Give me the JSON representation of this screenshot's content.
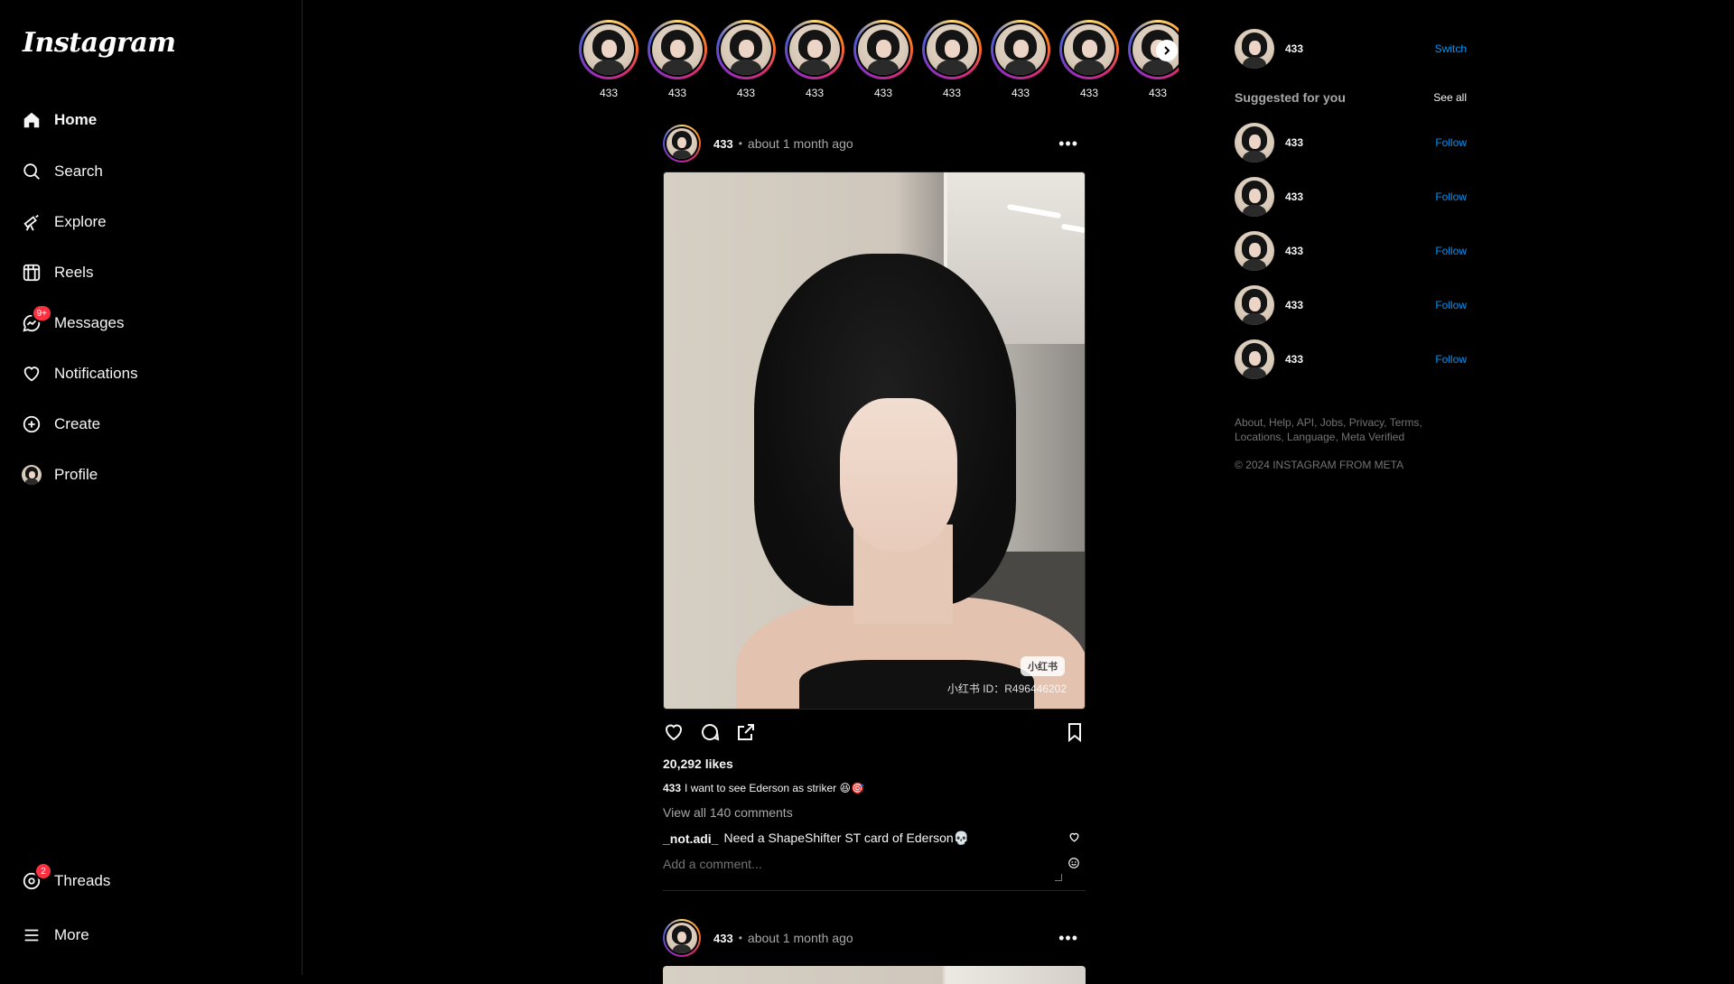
{
  "sidebar": {
    "logo": "Instagram",
    "items": [
      {
        "label": "Home",
        "icon": "home-icon"
      },
      {
        "label": "Search",
        "icon": "search-icon"
      },
      {
        "label": "Explore",
        "icon": "explore-icon"
      },
      {
        "label": "Reels",
        "icon": "reels-icon"
      },
      {
        "label": "Messages",
        "icon": "messages-icon",
        "badge": "9+"
      },
      {
        "label": "Notifications",
        "icon": "heart-icon"
      },
      {
        "label": "Create",
        "icon": "plus-circle-icon"
      },
      {
        "label": "Profile",
        "icon": "avatar"
      }
    ],
    "bottom": [
      {
        "label": "Threads",
        "icon": "threads-icon",
        "badge": "2"
      },
      {
        "label": "More",
        "icon": "hamburger-icon"
      }
    ]
  },
  "stories": [
    "433",
    "433",
    "433",
    "433",
    "433",
    "433",
    "433",
    "433",
    "433"
  ],
  "posts": [
    {
      "user": "433",
      "separator": "•",
      "time": "about 1 month ago",
      "likes": "20,292 likes",
      "caption_user": "433",
      "caption_text": "I want to see Ederson as striker 😆🎯",
      "view_all": "View all 140 comments",
      "comment_user": "_not.adi_",
      "comment_text": "Need a ShapeShifter ST card of Ederson💀",
      "add_comment_placeholder": "Add a comment...",
      "watermark_badge": "小红书",
      "watermark_id": "小红书 ID：R496446202"
    },
    {
      "user": "433",
      "separator": "•",
      "time": "about 1 month ago"
    }
  ],
  "right": {
    "me": {
      "name": "433",
      "action": "Switch"
    },
    "suggested_title": "Suggested for you",
    "see_all": "See all",
    "suggestions": [
      {
        "name": "433",
        "action": "Follow"
      },
      {
        "name": "433",
        "action": "Follow"
      },
      {
        "name": "433",
        "action": "Follow"
      },
      {
        "name": "433",
        "action": "Follow"
      },
      {
        "name": "433",
        "action": "Follow"
      }
    ],
    "footer_links": [
      "About",
      "Help",
      "API",
      "Jobs",
      "Privacy",
      "Terms",
      "Locations",
      "Language",
      "Meta Verified"
    ],
    "copyright": "© 2024 INSTAGRAM FROM META"
  },
  "colors": {
    "background": "#000000",
    "accent": "#0095f6",
    "badge": "#ff3040",
    "muted": "#a8a8a8"
  }
}
